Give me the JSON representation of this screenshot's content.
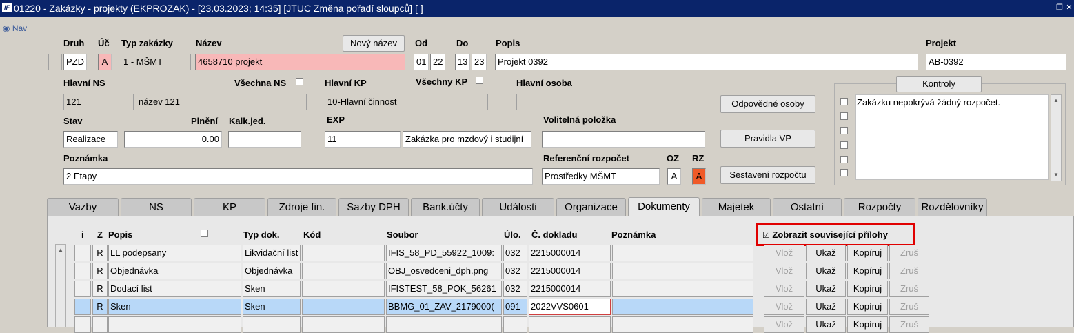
{
  "window": {
    "title": "01220 - Zakázky - projekty (EKPROZAK) - [23.03.2023; 14:35]  [JTUC Změna pořadí sloupců]  [ ]",
    "icon_text": "IF"
  },
  "nav": {
    "label": "Nav"
  },
  "header": {
    "druh": {
      "label": "Druh",
      "value": "PZD"
    },
    "uc": {
      "label": "Úč",
      "value": "A"
    },
    "typ": {
      "label": "Typ zakázky",
      "value": "1 - MŠMT"
    },
    "nazev": {
      "label": "Název",
      "value": "4658710 projekt"
    },
    "novy_nazev_button": "Nový název",
    "od": {
      "label": "Od",
      "v1": "01",
      "v2": "22"
    },
    "do": {
      "label": "Do",
      "v1": "13",
      "v2": "23"
    },
    "popis": {
      "label": "Popis",
      "value": "Projekt 0392"
    },
    "projekt": {
      "label": "Projekt",
      "value": "AB-0392"
    },
    "hlavni_ns": {
      "label": "Hlavní NS",
      "code": "121",
      "name": "název 121"
    },
    "vsechna_ns": {
      "label": "Všechna NS"
    },
    "hlavni_kp": {
      "label": "Hlavní KP",
      "value": "10-Hlavní činnost"
    },
    "vsechny_kp": {
      "label": "Všechny KP"
    },
    "hlavni_osoba": {
      "label": "Hlavní osoba",
      "value": ""
    },
    "stav": {
      "label": "Stav",
      "value": "Realizace"
    },
    "plneni": {
      "label": "Plnění",
      "value": "0.00"
    },
    "kalk": {
      "label": "Kalk.jed.",
      "value": ""
    },
    "exp": {
      "label": "EXP",
      "code": "11",
      "name": "Zakázka pro mzdový i studijní"
    },
    "volitelna": {
      "label": "Volitelná položka",
      "value": ""
    },
    "poznamka": {
      "label": "Poznámka",
      "value": "2 Etapy"
    },
    "ref_rozpocet": {
      "label": "Referenční rozpočet",
      "value": "Prostředky MŠMT"
    },
    "oz": {
      "label": "OZ",
      "value": "A"
    },
    "rz": {
      "label": "RZ",
      "value": "A"
    },
    "buttons": {
      "odpovedne": "Odpovědné osoby",
      "pravidla": "Pravidla VP",
      "sestaveni": "Sestavení rozpočtu"
    },
    "kontroly": {
      "label": "Kontroly",
      "items": [
        "Zakázku nepokrývá žádný rozpočet.",
        "",
        "",
        "",
        "",
        ""
      ]
    }
  },
  "tabs": [
    "Vazby",
    "NS",
    "KP",
    "Zdroje fin.",
    "Sazby DPH",
    "Bank.účty",
    "Události",
    "Organizace",
    "Dokumenty",
    "Majetek",
    "Ostatní",
    "Rozpočty",
    "Rozdělovníky"
  ],
  "active_tab": "Dokumenty",
  "documents": {
    "columns": {
      "i": "i",
      "z": "Z",
      "popis": "Popis",
      "typ": "Typ dok.",
      "kod": "Kód",
      "soubor": "Soubor",
      "ulo": "Úlo.",
      "cislo": "Č. dokladu",
      "poznamka": "Poznámka"
    },
    "show_related_label": "Zobrazit související přílohy",
    "row_buttons": {
      "vloz": "Vlož",
      "ukaz": "Ukaž",
      "kopiruj": "Kopíruj",
      "zrus": "Zruš"
    },
    "rows": [
      {
        "z": "R",
        "popis": "LL podepsany",
        "typ": "Likvidační list",
        "kod": "",
        "soubor": "IFIS_58_PD_55922_1009:",
        "ulo": "032",
        "cislo": "2215000014",
        "poznamka": ""
      },
      {
        "z": "R",
        "popis": "Objednávka",
        "typ": "Objednávka",
        "kod": "",
        "soubor": "OBJ_osvedceni_dph.png",
        "ulo": "032",
        "cislo": "2215000014",
        "poznamka": ""
      },
      {
        "z": "R",
        "popis": "Dodací list",
        "typ": "Sken",
        "kod": "",
        "soubor": "IFISTEST_58_POK_56261",
        "ulo": "032",
        "cislo": "2215000014",
        "poznamka": ""
      },
      {
        "z": "R",
        "popis": "Sken",
        "typ": "Sken",
        "kod": "",
        "soubor": "BBMG_01_ZAV_2179000(",
        "ulo": "091",
        "cislo": "2022VVS0601",
        "poznamka": ""
      },
      {
        "z": "",
        "popis": "",
        "typ": "",
        "kod": "",
        "soubor": "",
        "ulo": "",
        "cislo": "",
        "poznamka": ""
      }
    ]
  }
}
